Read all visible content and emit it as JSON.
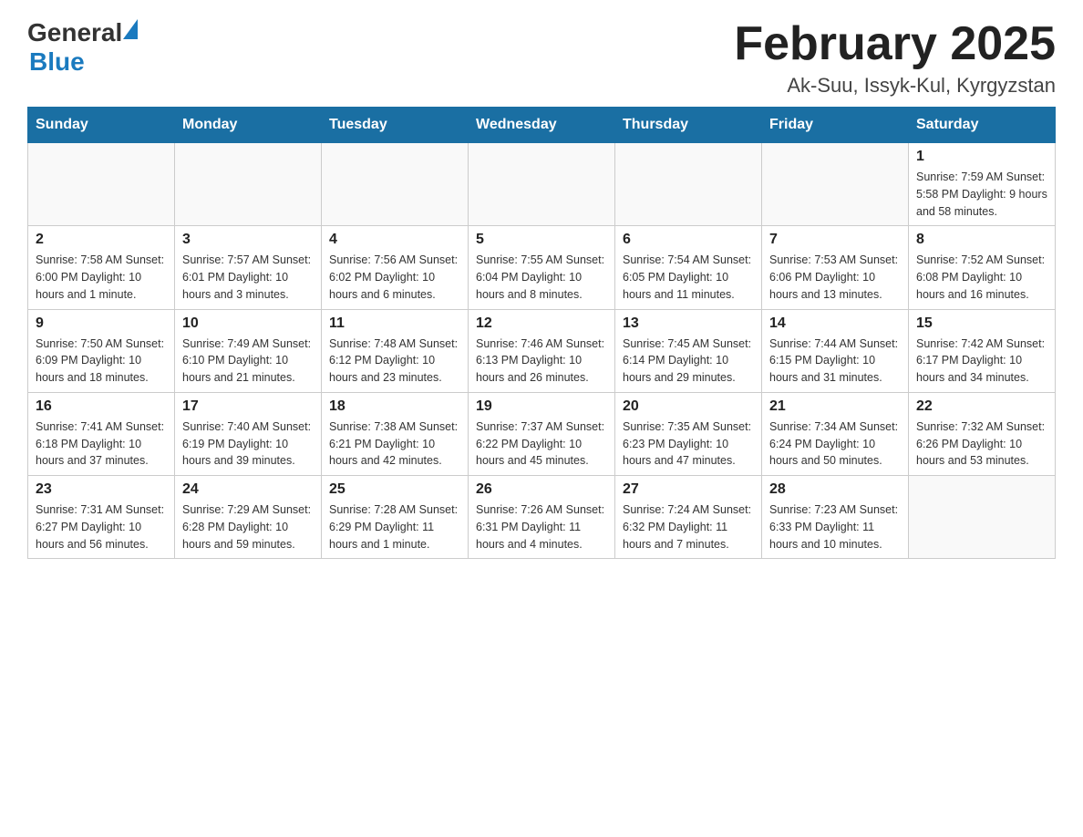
{
  "header": {
    "logo_general": "General",
    "logo_blue": "Blue",
    "month_title": "February 2025",
    "location": "Ak-Suu, Issyk-Kul, Kyrgyzstan"
  },
  "days_of_week": [
    "Sunday",
    "Monday",
    "Tuesday",
    "Wednesday",
    "Thursday",
    "Friday",
    "Saturday"
  ],
  "weeks": [
    {
      "days": [
        {
          "number": "",
          "info": ""
        },
        {
          "number": "",
          "info": ""
        },
        {
          "number": "",
          "info": ""
        },
        {
          "number": "",
          "info": ""
        },
        {
          "number": "",
          "info": ""
        },
        {
          "number": "",
          "info": ""
        },
        {
          "number": "1",
          "info": "Sunrise: 7:59 AM\nSunset: 5:58 PM\nDaylight: 9 hours\nand 58 minutes."
        }
      ]
    },
    {
      "days": [
        {
          "number": "2",
          "info": "Sunrise: 7:58 AM\nSunset: 6:00 PM\nDaylight: 10 hours\nand 1 minute."
        },
        {
          "number": "3",
          "info": "Sunrise: 7:57 AM\nSunset: 6:01 PM\nDaylight: 10 hours\nand 3 minutes."
        },
        {
          "number": "4",
          "info": "Sunrise: 7:56 AM\nSunset: 6:02 PM\nDaylight: 10 hours\nand 6 minutes."
        },
        {
          "number": "5",
          "info": "Sunrise: 7:55 AM\nSunset: 6:04 PM\nDaylight: 10 hours\nand 8 minutes."
        },
        {
          "number": "6",
          "info": "Sunrise: 7:54 AM\nSunset: 6:05 PM\nDaylight: 10 hours\nand 11 minutes."
        },
        {
          "number": "7",
          "info": "Sunrise: 7:53 AM\nSunset: 6:06 PM\nDaylight: 10 hours\nand 13 minutes."
        },
        {
          "number": "8",
          "info": "Sunrise: 7:52 AM\nSunset: 6:08 PM\nDaylight: 10 hours\nand 16 minutes."
        }
      ]
    },
    {
      "days": [
        {
          "number": "9",
          "info": "Sunrise: 7:50 AM\nSunset: 6:09 PM\nDaylight: 10 hours\nand 18 minutes."
        },
        {
          "number": "10",
          "info": "Sunrise: 7:49 AM\nSunset: 6:10 PM\nDaylight: 10 hours\nand 21 minutes."
        },
        {
          "number": "11",
          "info": "Sunrise: 7:48 AM\nSunset: 6:12 PM\nDaylight: 10 hours\nand 23 minutes."
        },
        {
          "number": "12",
          "info": "Sunrise: 7:46 AM\nSunset: 6:13 PM\nDaylight: 10 hours\nand 26 minutes."
        },
        {
          "number": "13",
          "info": "Sunrise: 7:45 AM\nSunset: 6:14 PM\nDaylight: 10 hours\nand 29 minutes."
        },
        {
          "number": "14",
          "info": "Sunrise: 7:44 AM\nSunset: 6:15 PM\nDaylight: 10 hours\nand 31 minutes."
        },
        {
          "number": "15",
          "info": "Sunrise: 7:42 AM\nSunset: 6:17 PM\nDaylight: 10 hours\nand 34 minutes."
        }
      ]
    },
    {
      "days": [
        {
          "number": "16",
          "info": "Sunrise: 7:41 AM\nSunset: 6:18 PM\nDaylight: 10 hours\nand 37 minutes."
        },
        {
          "number": "17",
          "info": "Sunrise: 7:40 AM\nSunset: 6:19 PM\nDaylight: 10 hours\nand 39 minutes."
        },
        {
          "number": "18",
          "info": "Sunrise: 7:38 AM\nSunset: 6:21 PM\nDaylight: 10 hours\nand 42 minutes."
        },
        {
          "number": "19",
          "info": "Sunrise: 7:37 AM\nSunset: 6:22 PM\nDaylight: 10 hours\nand 45 minutes."
        },
        {
          "number": "20",
          "info": "Sunrise: 7:35 AM\nSunset: 6:23 PM\nDaylight: 10 hours\nand 47 minutes."
        },
        {
          "number": "21",
          "info": "Sunrise: 7:34 AM\nSunset: 6:24 PM\nDaylight: 10 hours\nand 50 minutes."
        },
        {
          "number": "22",
          "info": "Sunrise: 7:32 AM\nSunset: 6:26 PM\nDaylight: 10 hours\nand 53 minutes."
        }
      ]
    },
    {
      "days": [
        {
          "number": "23",
          "info": "Sunrise: 7:31 AM\nSunset: 6:27 PM\nDaylight: 10 hours\nand 56 minutes."
        },
        {
          "number": "24",
          "info": "Sunrise: 7:29 AM\nSunset: 6:28 PM\nDaylight: 10 hours\nand 59 minutes."
        },
        {
          "number": "25",
          "info": "Sunrise: 7:28 AM\nSunset: 6:29 PM\nDaylight: 11 hours\nand 1 minute."
        },
        {
          "number": "26",
          "info": "Sunrise: 7:26 AM\nSunset: 6:31 PM\nDaylight: 11 hours\nand 4 minutes."
        },
        {
          "number": "27",
          "info": "Sunrise: 7:24 AM\nSunset: 6:32 PM\nDaylight: 11 hours\nand 7 minutes."
        },
        {
          "number": "28",
          "info": "Sunrise: 7:23 AM\nSunset: 6:33 PM\nDaylight: 11 hours\nand 10 minutes."
        },
        {
          "number": "",
          "info": ""
        }
      ]
    }
  ]
}
